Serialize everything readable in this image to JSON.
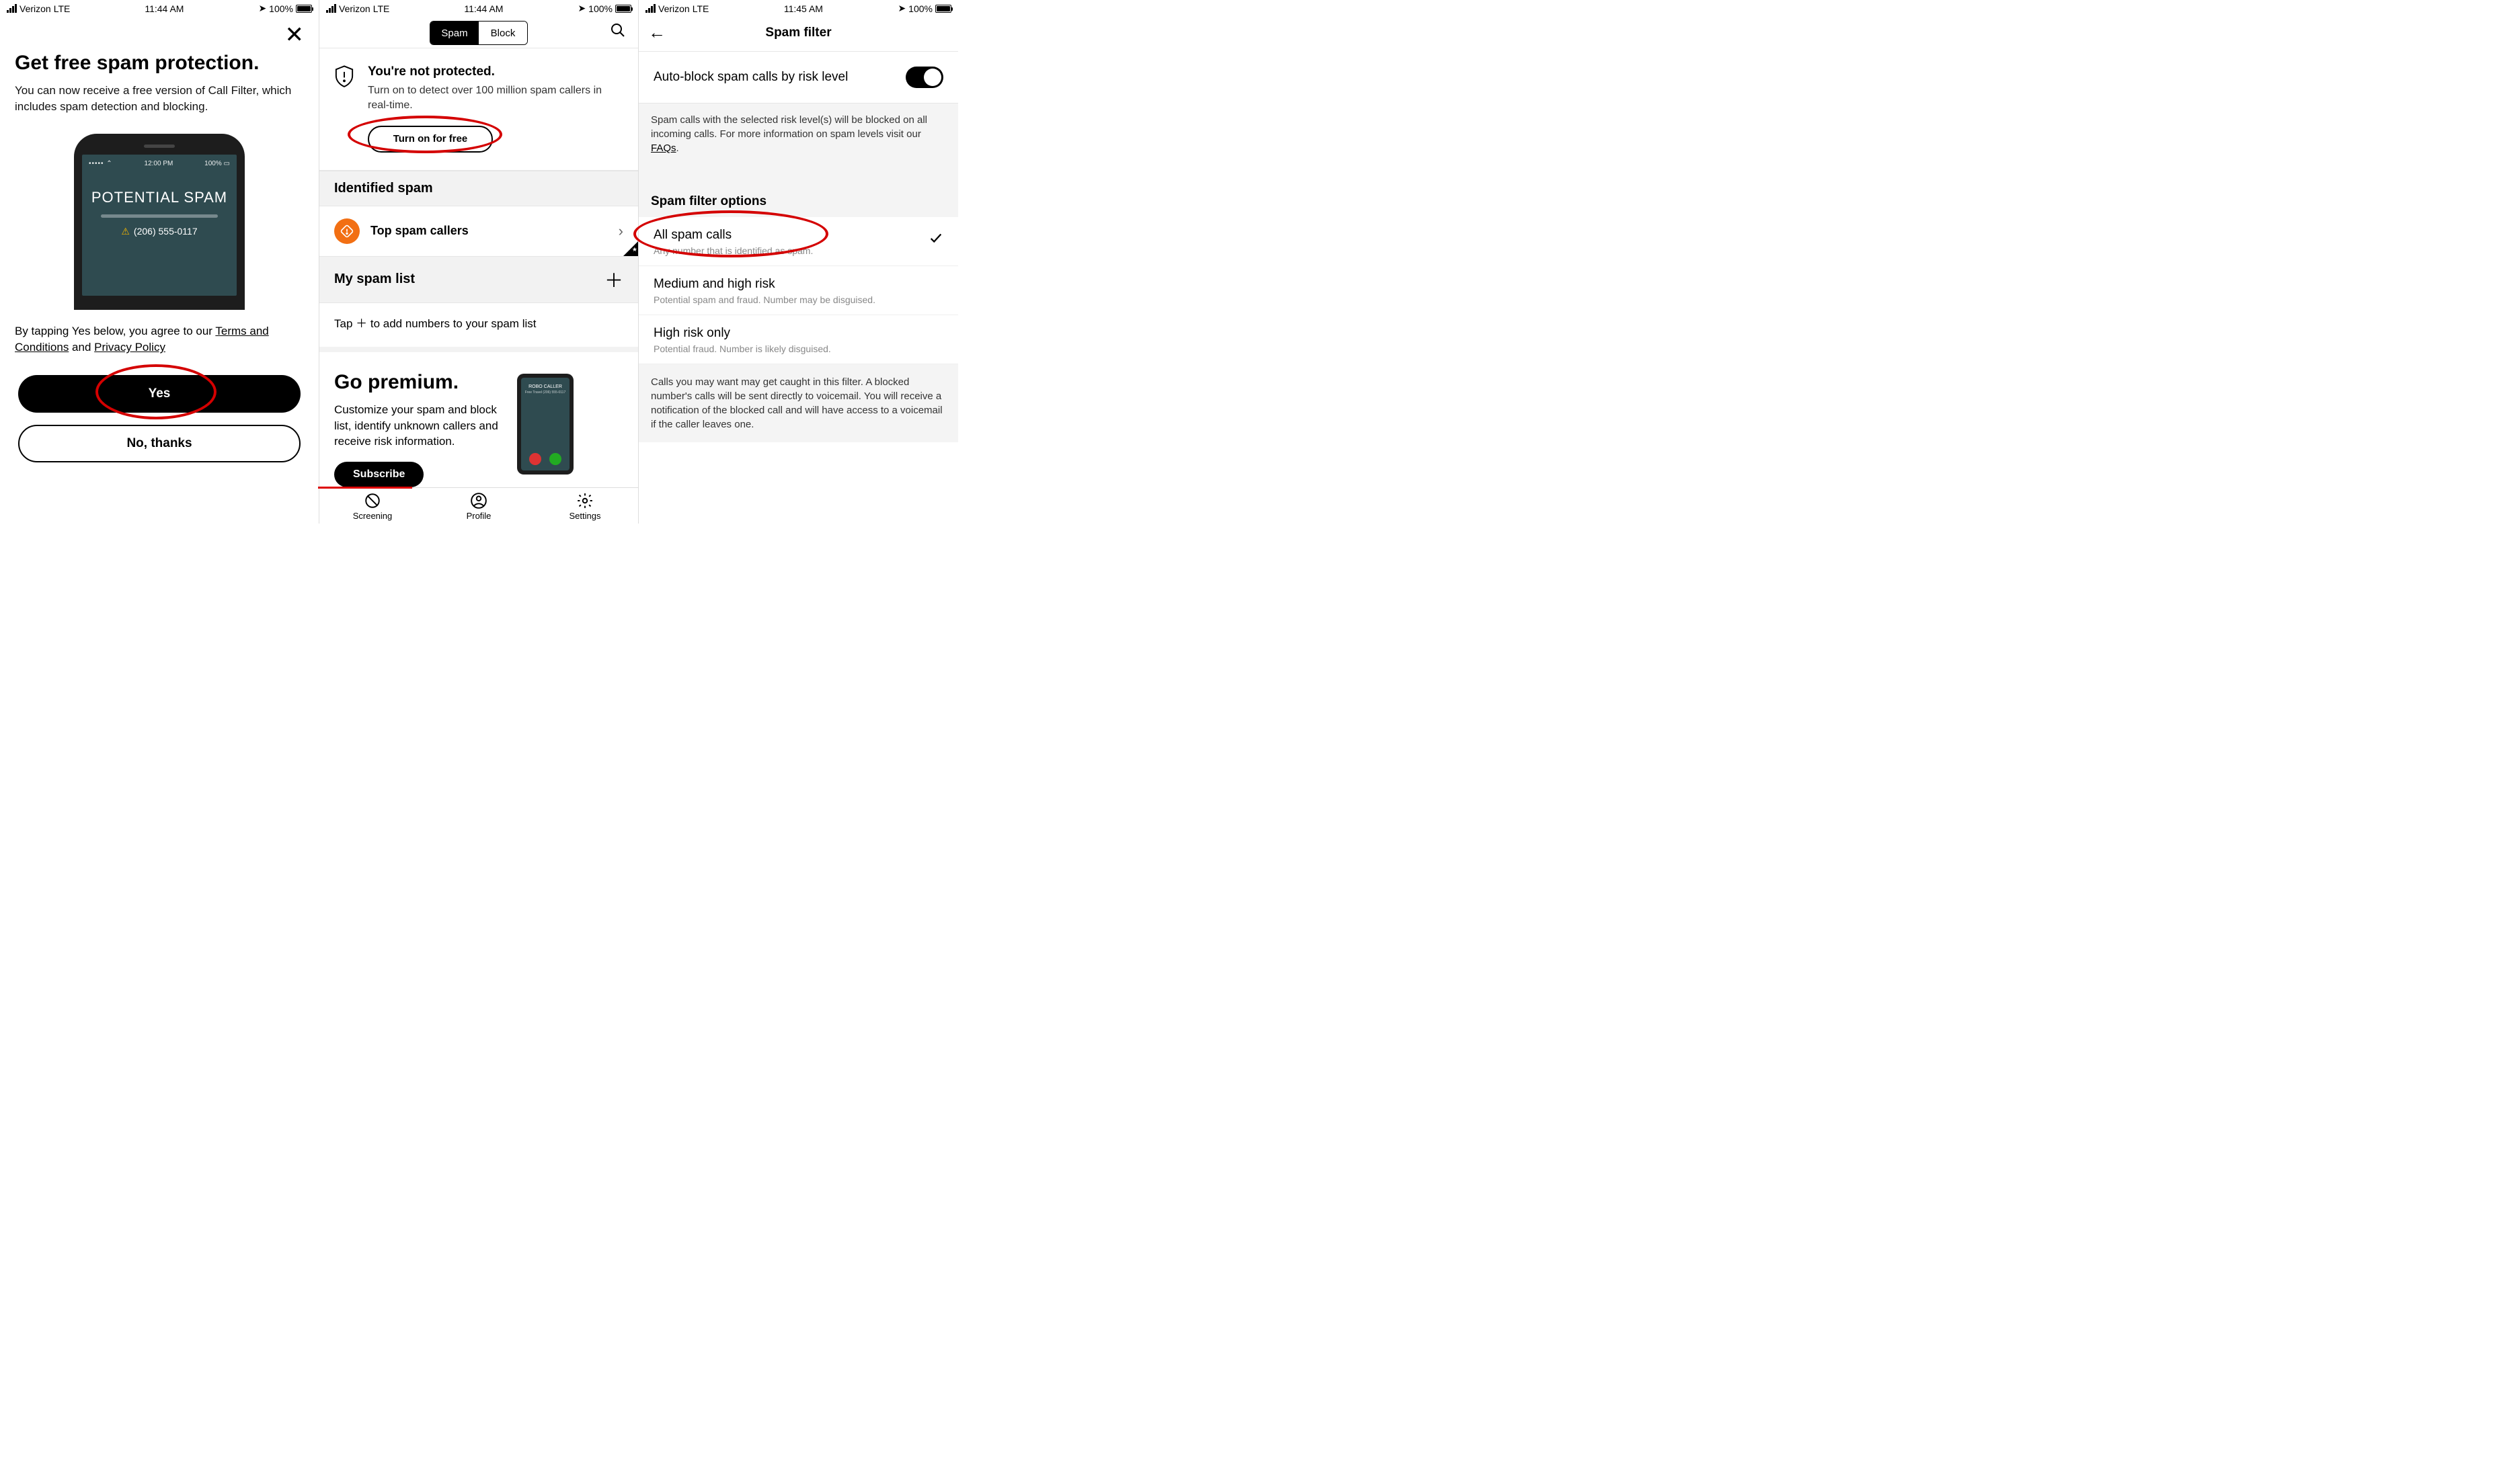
{
  "status": {
    "carrier": "Verizon",
    "net": "LTE",
    "time1": "11:44 AM",
    "time2": "11:44 AM",
    "time3": "11:45 AM",
    "batt": "100%"
  },
  "s1": {
    "title": "Get free spam protection.",
    "body": "You can now receive a free version of Call Filter, which includes spam detection and blocking.",
    "mock": {
      "time": "12:00 PM",
      "batt": "100%",
      "headline": "POTENTIAL SPAM",
      "number": "(206) 555-0117"
    },
    "terms_pre": "By tapping Yes below, you agree to our ",
    "terms_link1": "Terms and Conditions",
    "terms_mid": " and ",
    "terms_link2": "Privacy Policy",
    "yes": "Yes",
    "no": "No, thanks"
  },
  "s2": {
    "tabs": {
      "spam": "Spam",
      "block": "Block"
    },
    "protect": {
      "title": "You're not protected.",
      "body": "Turn on to detect over 100 million spam callers in real-time.",
      "cta": "Turn on for free"
    },
    "identified": "Identified spam",
    "top_spam": "Top spam callers",
    "my_list": "My spam list",
    "tap_note": "Tap ＋ to add numbers to your spam list",
    "premium": {
      "title": "Go premium.",
      "body": "Customize your spam and block list, identify unknown callers and receive risk information.",
      "cta": "Subscribe",
      "mock": {
        "headline": "ROBO CALLER",
        "sub": "Free Travel  (206) 555-0117"
      }
    },
    "tabs_bottom": {
      "screening": "Screening",
      "profile": "Profile",
      "settings": "Settings"
    }
  },
  "s3": {
    "title": "Spam filter",
    "auto": "Auto-block spam calls by risk level",
    "note1_a": "Spam calls with the selected risk level(s) will be blocked on all incoming calls. For more information on spam levels visit our ",
    "note1_link": "FAQs",
    "note1_b": ".",
    "options_head": "Spam filter options",
    "opts": [
      {
        "t": "All spam calls",
        "s": "Any number that is identified as spam.",
        "checked": true
      },
      {
        "t": "Medium and high risk",
        "s": "Potential spam and fraud. Number may be disguised.",
        "checked": false
      },
      {
        "t": "High risk only",
        "s": "Potential fraud. Number is likely disguised.",
        "checked": false
      }
    ],
    "footnote": "Calls you may want may get caught in this filter. A blocked number's calls will be sent directly to voicemail. You will receive a notification of the blocked call and will have access to a voicemail if the caller leaves one."
  }
}
